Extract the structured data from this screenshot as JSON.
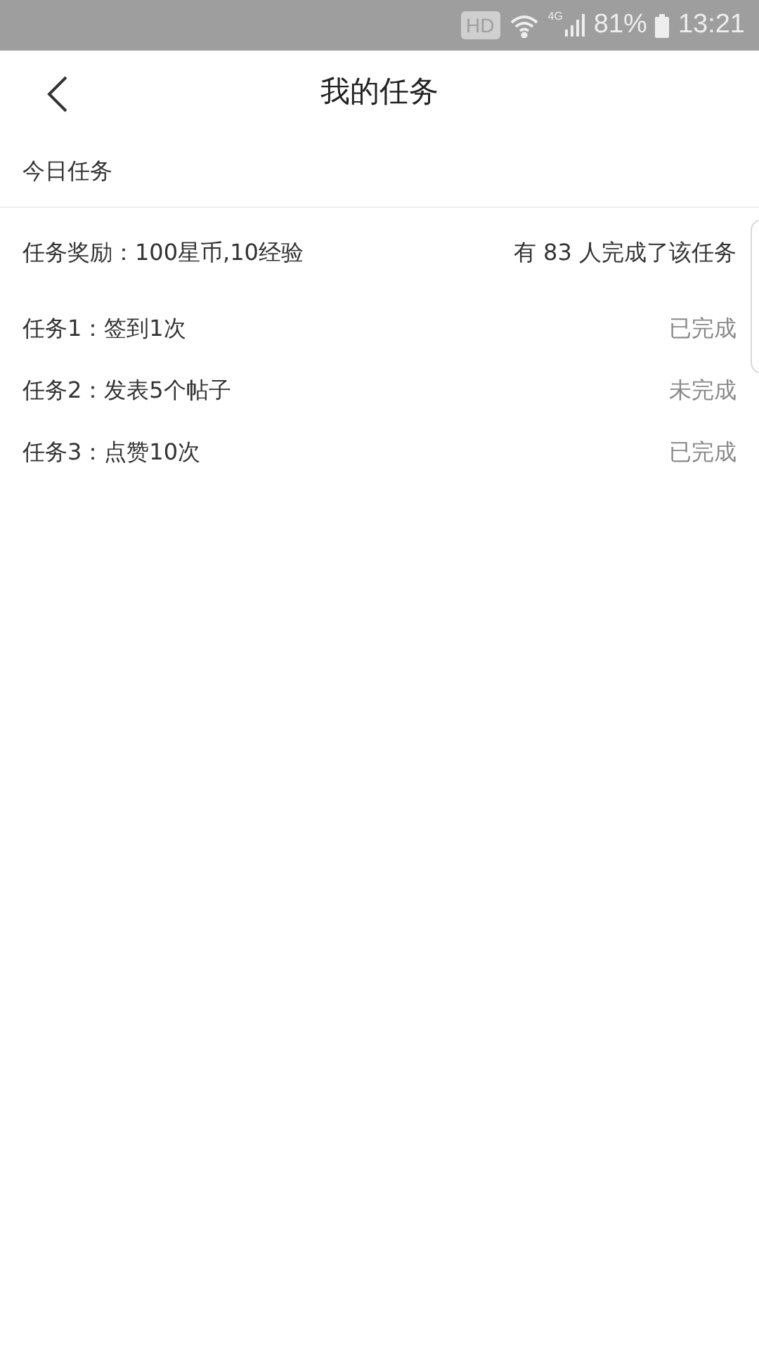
{
  "status_bar": {
    "hd": "HD",
    "network": "4G",
    "battery": "81%",
    "time": "13:21"
  },
  "header": {
    "title": "我的任务"
  },
  "section": {
    "title": "今日任务"
  },
  "reward": {
    "label": "任务奖励：100星币,10经验",
    "completed_count": "有 83 人完成了该任务"
  },
  "tasks": [
    {
      "name": "任务1：签到1次",
      "status": "已完成"
    },
    {
      "name": "任务2：发表5个帖子",
      "status": "未完成"
    },
    {
      "name": "任务3：点赞10次",
      "status": "已完成"
    }
  ]
}
